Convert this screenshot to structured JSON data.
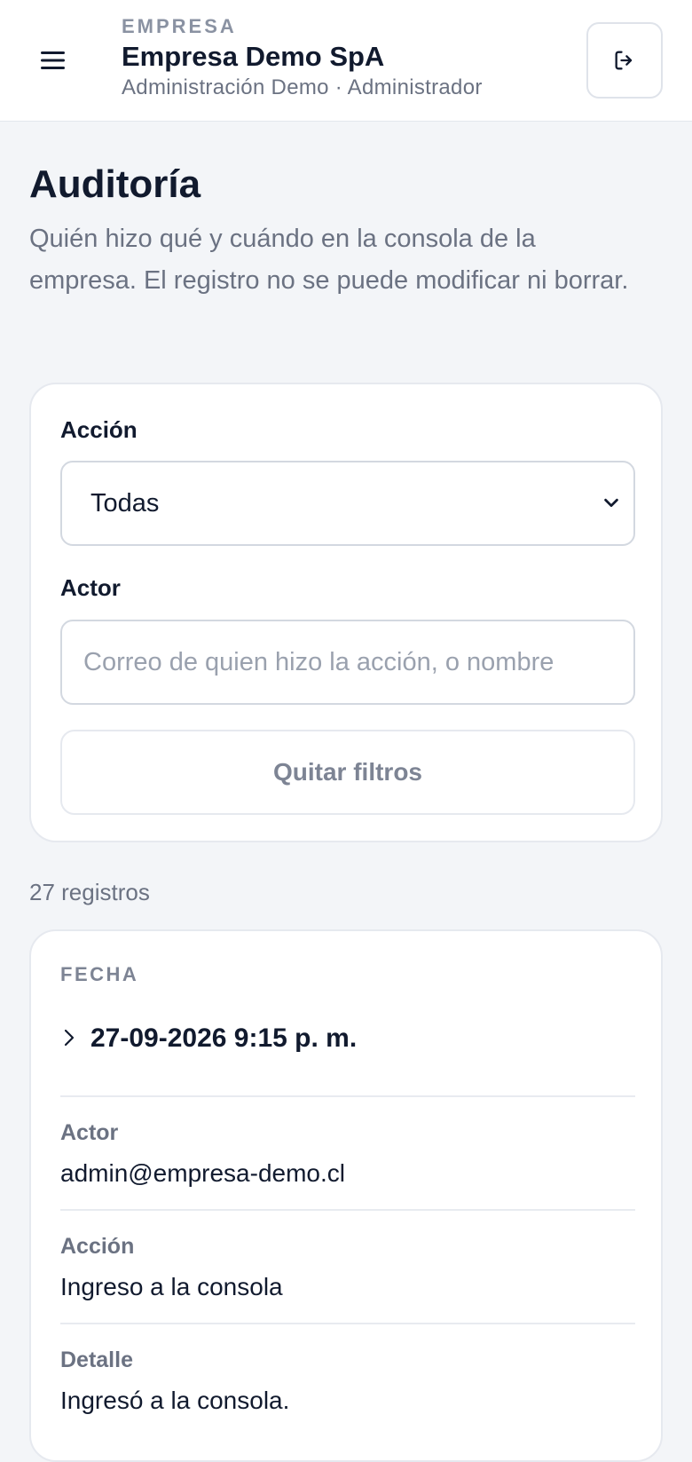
{
  "header": {
    "eyebrow": "EMPRESA",
    "company": "Empresa Demo SpA",
    "subtitle": "Administración Demo · Administrador",
    "menu_icon": "hamburger-icon",
    "logout_icon": "logout-icon"
  },
  "page": {
    "title": "Auditoría",
    "description": "Quién hizo qué y cuándo en la consola de la empresa. El registro no se puede modificar ni borrar."
  },
  "filters": {
    "action_label": "Acción",
    "action_value": "Todas",
    "actor_label": "Actor",
    "actor_placeholder": "Correo de quien hizo la acción, o nombre",
    "actor_value": "",
    "clear_label": "Quitar filtros"
  },
  "results": {
    "count_text": "27 registros"
  },
  "record": {
    "date_header": "FECHA",
    "date_value": "27-09-2026 9:15 p. m.",
    "actor_label": "Actor",
    "actor_value": "admin@empresa-demo.cl",
    "action_label": "Acción",
    "action_value": "Ingreso a la consola",
    "detail_label": "Detalle",
    "detail_value": "Ingresó a la consola."
  }
}
